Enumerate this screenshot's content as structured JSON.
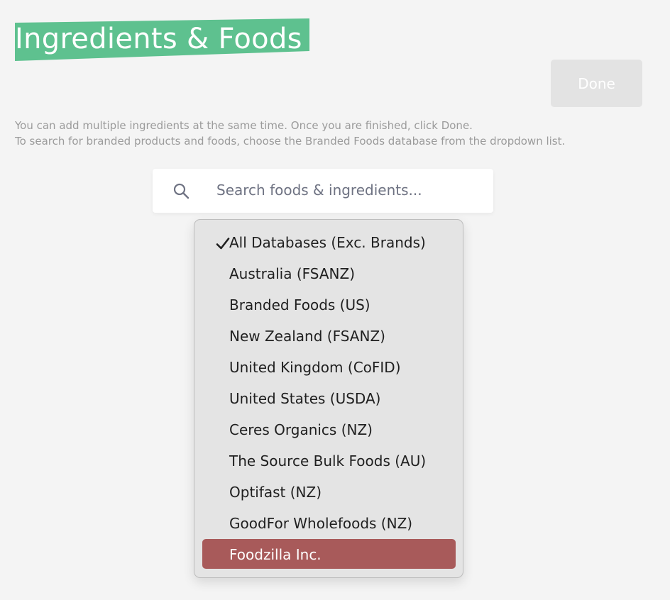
{
  "page": {
    "title": "Ingredients & Foods",
    "title_highlight_color": "#5ec18f",
    "done_label": "Done",
    "help_line_1": "You can add multiple ingredients at the same time. Once you are finished, click Done.",
    "help_line_2": "To search for branded products and foods, choose the Branded Foods database from the dropdown list."
  },
  "search": {
    "placeholder": "Search foods & ingredients...",
    "value": "",
    "icon": "search-icon"
  },
  "dropdown": {
    "checked_index": 0,
    "highlighted_index": 10,
    "highlight_color": "#a85a5a",
    "options": [
      {
        "label": "All Databases (Exc. Brands)"
      },
      {
        "label": "Australia (FSANZ)"
      },
      {
        "label": "Branded Foods (US)"
      },
      {
        "label": "New Zealand (FSANZ)"
      },
      {
        "label": "United Kingdom (CoFID)"
      },
      {
        "label": "United States (USDA)"
      },
      {
        "label": "Ceres Organics (NZ)"
      },
      {
        "label": "The Source Bulk Foods (AU)"
      },
      {
        "label": "Optifast (NZ)"
      },
      {
        "label": "GoodFor Wholefoods (NZ)"
      },
      {
        "label": "Foodzilla Inc."
      }
    ]
  }
}
